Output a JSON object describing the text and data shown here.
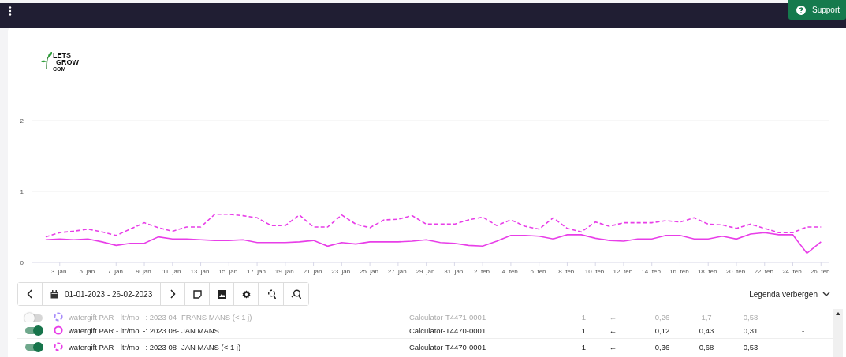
{
  "top_bar": {
    "support_label": "Support"
  },
  "logo": {
    "line_1": "LETS",
    "line_2": "GROW",
    "line_3": "COM"
  },
  "chart": {
    "chart_data": {
      "type": "line",
      "categories": [
        null,
        "3. jan.",
        null,
        "5. jan.",
        null,
        "7. jan.",
        null,
        "9. jan.",
        null,
        "11. jan.",
        null,
        "13. jan.",
        null,
        "15. jan.",
        null,
        "17. jan.",
        null,
        "19. jan.",
        null,
        "21. jan.",
        null,
        "23. jan.",
        null,
        "25. jan.",
        null,
        "27. jan.",
        null,
        "29. jan.",
        null,
        "31. jan.",
        null,
        "2. feb.",
        null,
        "4. feb.",
        null,
        "6. feb.",
        null,
        "8. feb.",
        null,
        "10. feb.",
        null,
        "12. feb.",
        null,
        "14. feb.",
        null,
        "16. feb.",
        null,
        "18. feb.",
        null,
        "20. feb.",
        null,
        "22. feb.",
        null,
        "24. feb.",
        null,
        "26. feb."
      ],
      "ylim": [
        0,
        2
      ],
      "yticks": [
        0,
        1,
        2
      ],
      "series": [
        {
          "color": "#e83ee8",
          "line_style": "solid",
          "values": [
            0.32,
            0.33,
            0.32,
            0.33,
            0.29,
            0.24,
            0.27,
            0.27,
            0.36,
            0.33,
            0.33,
            0.32,
            0.31,
            0.31,
            0.32,
            0.28,
            0.28,
            0.28,
            0.29,
            0.31,
            0.23,
            0.28,
            0.26,
            0.29,
            0.29,
            0.29,
            0.3,
            0.32,
            0.28,
            0.27,
            0.24,
            0.23,
            0.3,
            0.38,
            0.38,
            0.37,
            0.33,
            0.39,
            0.39,
            0.34,
            0.31,
            0.3,
            0.33,
            0.33,
            0.38,
            0.38,
            0.33,
            0.33,
            0.37,
            0.33,
            0.4,
            0.42,
            0.39,
            0.39,
            0.13,
            0.29
          ]
        },
        {
          "color": "#e83ee8",
          "line_style": "dashed",
          "values": [
            0.36,
            0.42,
            0.44,
            0.47,
            0.43,
            0.38,
            0.47,
            0.56,
            0.49,
            0.44,
            0.5,
            0.5,
            0.68,
            0.68,
            0.66,
            0.63,
            0.52,
            0.52,
            0.67,
            0.5,
            0.5,
            0.67,
            0.54,
            0.49,
            0.6,
            0.61,
            0.66,
            0.54,
            0.54,
            0.54,
            0.6,
            0.64,
            0.52,
            0.6,
            0.51,
            0.47,
            0.63,
            0.48,
            0.43,
            0.57,
            0.51,
            0.56,
            0.56,
            0.56,
            0.59,
            0.57,
            0.63,
            0.54,
            0.53,
            0.48,
            0.54,
            0.48,
            0.42,
            0.42,
            0.5,
            0.5
          ]
        }
      ]
    }
  },
  "toolbar": {
    "date_range": "01-01-2023 - 26-02-2023"
  },
  "legend_toggle": "Legenda verbergen",
  "legend_rows": [
    {
      "enabled": false,
      "dashed": true,
      "color": "#a78bfa",
      "name": "watergift PAR - ltr/mol -: 2023 04- FRANS MANS (< 1 j)",
      "source": "Calculator-T4471-0001",
      "cells": [
        "1",
        "←",
        "0,26",
        "1,7",
        "0,58",
        "-"
      ]
    },
    {
      "enabled": true,
      "dashed": false,
      "color": "#e83ee8",
      "name": "watergift PAR - ltr/mol -: 2023 08- JAN MANS",
      "source": "Calculator-T4470-0001",
      "cells": [
        "1",
        "←",
        "0,12",
        "0,43",
        "0,31",
        "-"
      ]
    },
    {
      "enabled": true,
      "dashed": true,
      "color": "#e83ee8",
      "name": "watergift PAR - ltr/mol -: 2023 08- JAN MANS (< 1 j)",
      "source": "Calculator-T4470-0001",
      "cells": [
        "1",
        "←",
        "0,36",
        "0,68",
        "0,53",
        "-"
      ]
    }
  ]
}
